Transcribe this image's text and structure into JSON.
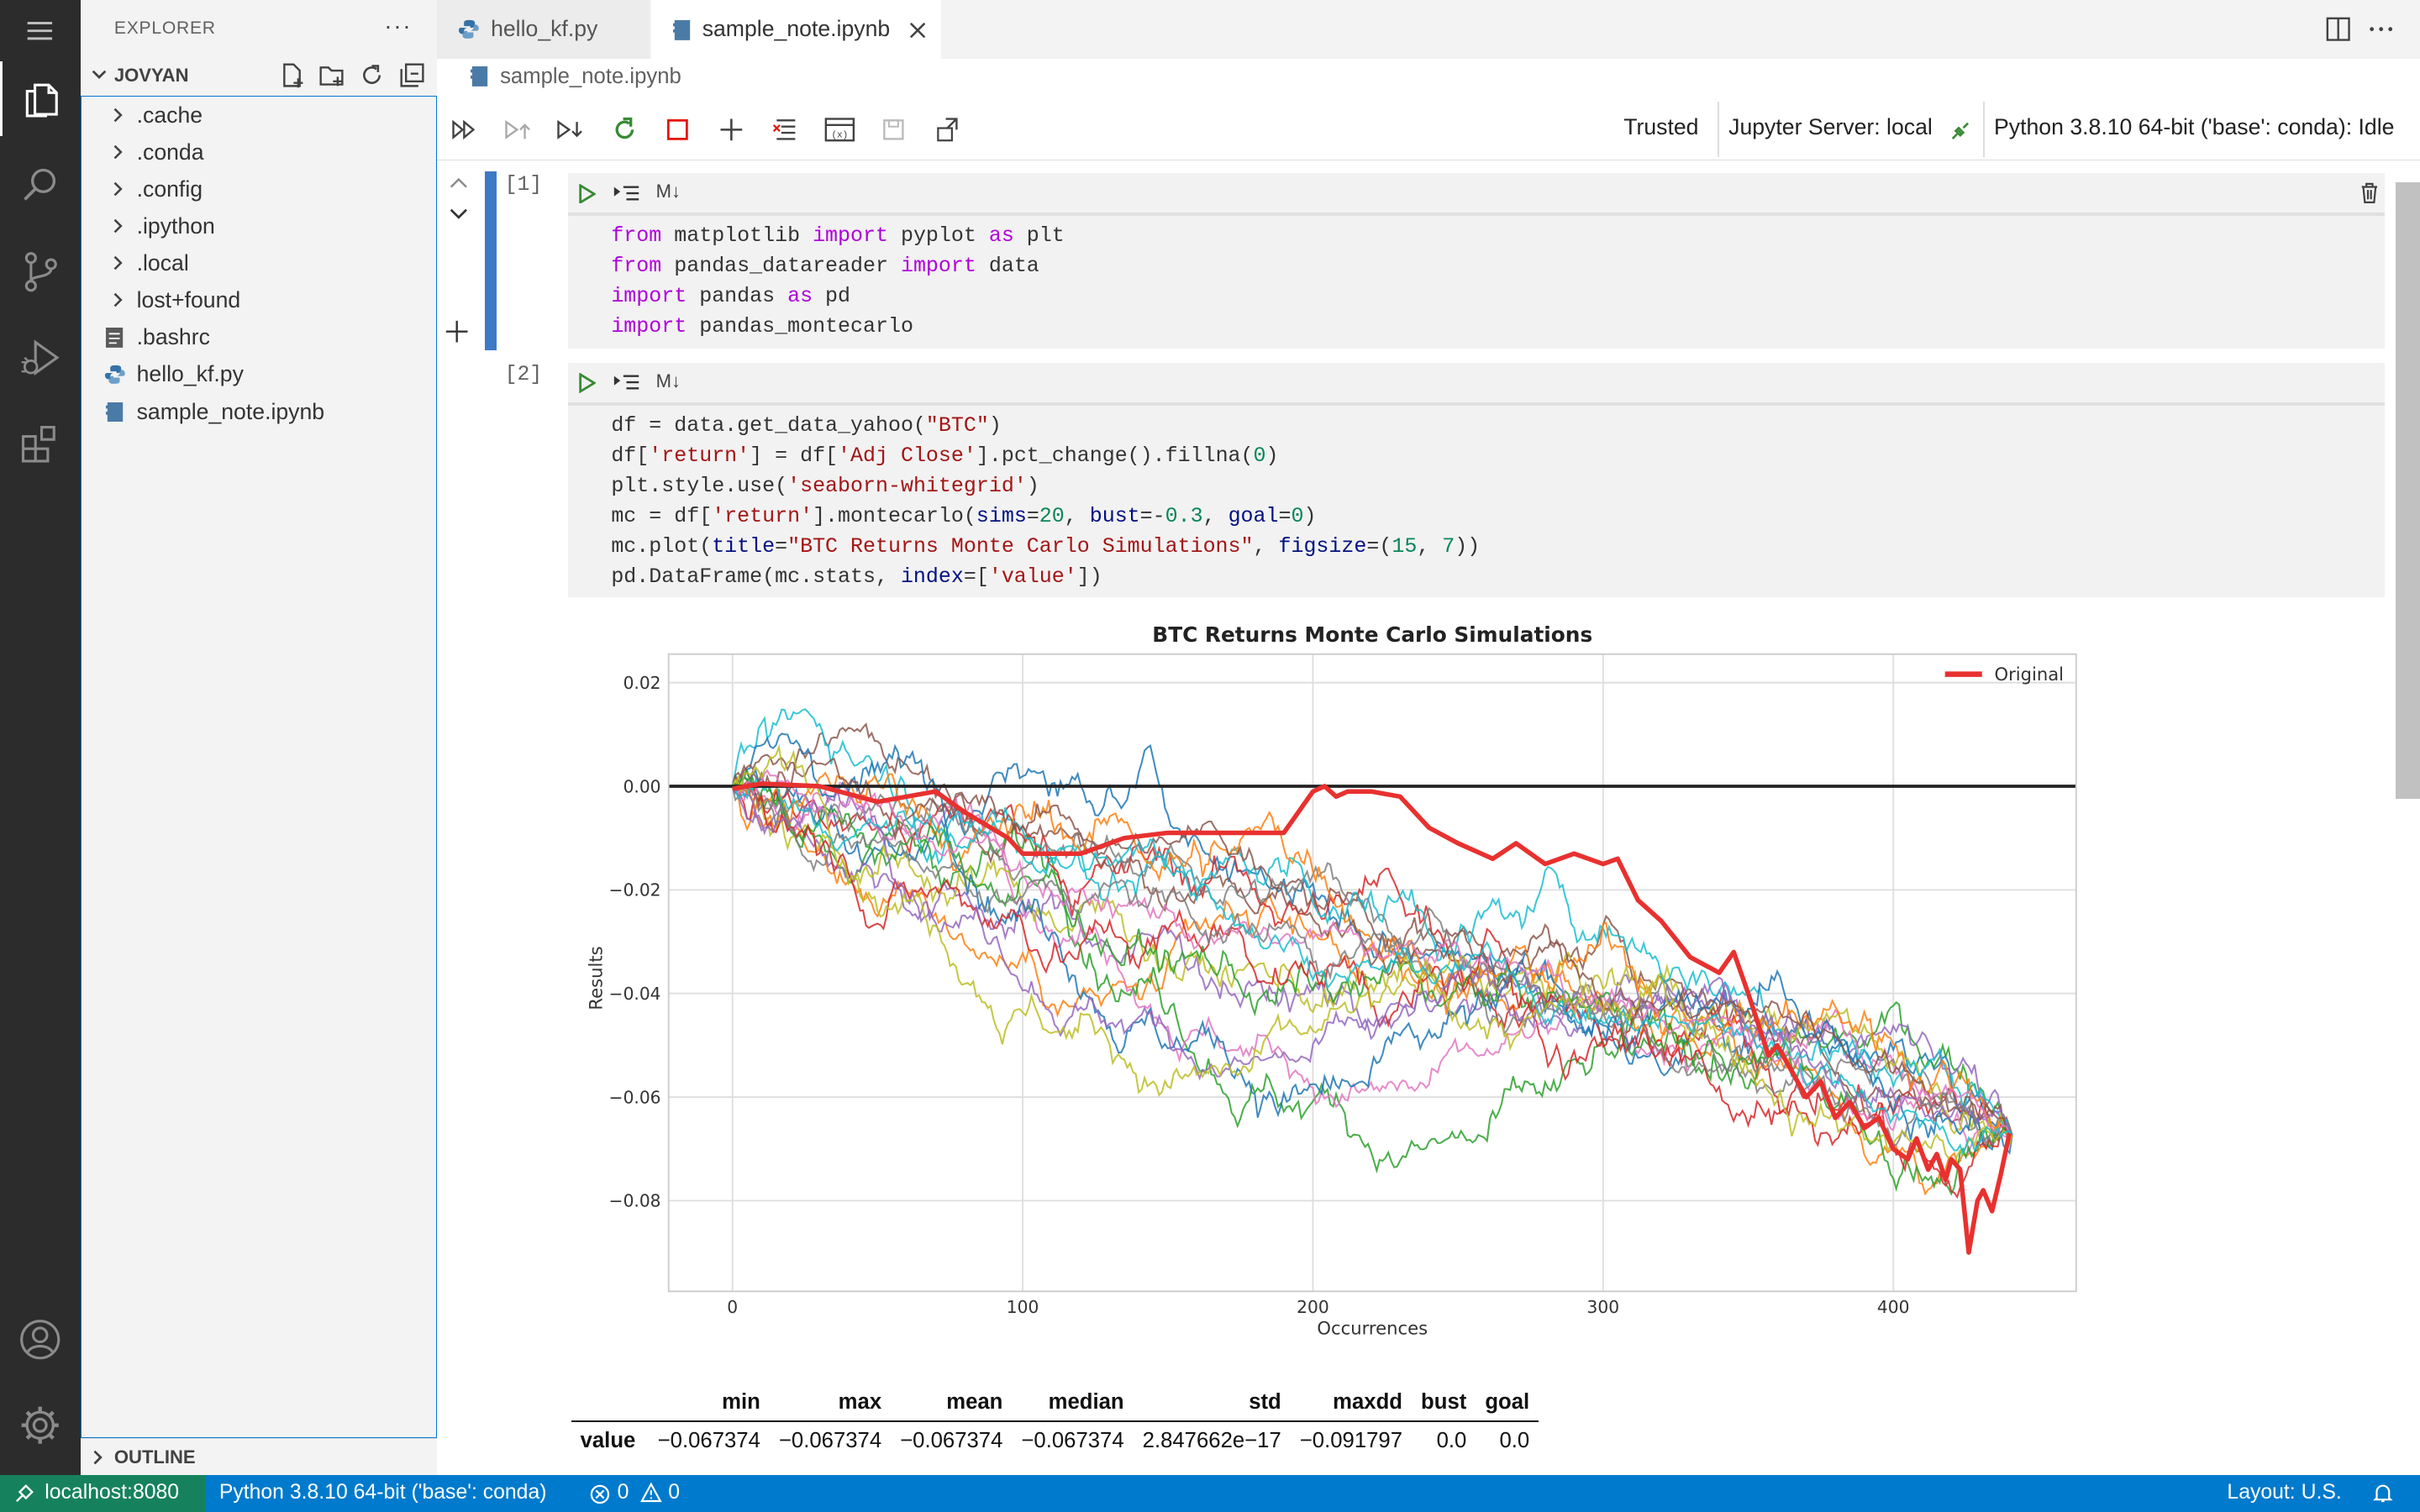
{
  "activity_bar": {
    "items": [
      "menu-icon",
      "files-icon",
      "search-icon",
      "source-control-icon",
      "run-debug-icon",
      "extensions-icon"
    ],
    "bottom": [
      "account-icon",
      "settings-gear-icon"
    ]
  },
  "sidebar": {
    "title": "EXPLORER",
    "more": "···",
    "section": "JOVYAN",
    "items": [
      {
        "label": ".cache",
        "kind": "folder"
      },
      {
        "label": ".conda",
        "kind": "folder"
      },
      {
        "label": ".config",
        "kind": "folder"
      },
      {
        "label": ".ipython",
        "kind": "folder"
      },
      {
        "label": ".local",
        "kind": "folder"
      },
      {
        "label": "lost+found",
        "kind": "folder"
      },
      {
        "label": ".bashrc",
        "kind": "file"
      },
      {
        "label": "hello_kf.py",
        "kind": "python"
      },
      {
        "label": "sample_note.ipynb",
        "kind": "notebook"
      }
    ],
    "outline": "OUTLINE"
  },
  "tabs": [
    {
      "label": "hello_kf.py",
      "active": false
    },
    {
      "label": "sample_note.ipynb",
      "active": true
    }
  ],
  "breadcrumb": "sample_note.ipynb",
  "toolbar": {
    "trusted": "Trusted",
    "server": "Jupyter Server: local",
    "kernel": "Python 3.8.10 64-bit ('base': conda): Idle"
  },
  "cells": [
    {
      "number": "[1]",
      "md_label": "M↓",
      "lines": [
        "from matplotlib import pyplot as plt",
        "from pandas_datareader import data",
        "import pandas as pd",
        "import pandas_montecarlo"
      ]
    },
    {
      "number": "[2]",
      "md_label": "M↓",
      "lines": [
        "df = data.get_data_yahoo(\"BTC\")",
        "df['return'] = df['Adj Close'].pct_change().fillna(0)",
        "plt.style.use('seaborn-whitegrid')",
        "mc = df['return'].montecarlo(sims=20, bust=-0.3, goal=0)",
        "mc.plot(title=\"BTC Returns Monte Carlo Simulations\", figsize=(15, 7))",
        "pd.DataFrame(mc.stats, index=['value'])"
      ]
    }
  ],
  "chart_data": {
    "type": "line",
    "title": "BTC Returns Monte Carlo Simulations",
    "xlabel": "Occurrences",
    "ylabel": "Results",
    "xlim": [
      -22,
      463
    ],
    "ylim": [
      -0.0975,
      0.0255
    ],
    "x_ticks": [
      0,
      100,
      200,
      300,
      400
    ],
    "x_tick_labels": [
      "0",
      "100",
      "200",
      "300",
      "400"
    ],
    "y_ticks": [
      0.02,
      0.0,
      -0.02,
      -0.04,
      -0.06,
      -0.08
    ],
    "y_tick_labels": [
      "0.02",
      "0.00",
      "−0.02",
      "−0.04",
      "−0.06",
      "−0.08"
    ],
    "grid": true,
    "legend": {
      "position": "top-right",
      "entries": [
        "Original"
      ]
    },
    "reference_line": {
      "y": 0.0,
      "color": "#222222"
    },
    "simulations": {
      "count": 20,
      "points": 442,
      "end_value": -0.067374,
      "colors": [
        "#1f77b4",
        "#ff7f0e",
        "#2ca02c",
        "#d62728",
        "#9467bd",
        "#8c564b",
        "#e377c2",
        "#7f7f7f",
        "#bcbd22",
        "#17becf"
      ]
    },
    "series": [
      {
        "name": "Original",
        "color": "#e8312f",
        "x": [
          0,
          10,
          30,
          50,
          70,
          80,
          95,
          100,
          120,
          135,
          150,
          170,
          190,
          200,
          204,
          208,
          212,
          220,
          230,
          240,
          250,
          262,
          270,
          280,
          290,
          300,
          305,
          312,
          320,
          330,
          340,
          345,
          350,
          357,
          360,
          365,
          370,
          375,
          380,
          385,
          390,
          395,
          400,
          405,
          408,
          412,
          415,
          418,
          420,
          423,
          426,
          429,
          431,
          434,
          437,
          440
        ],
        "y": [
          -0.0005,
          0.0005,
          0.0,
          -0.003,
          -0.001,
          -0.005,
          -0.01,
          -0.013,
          -0.013,
          -0.01,
          -0.009,
          -0.009,
          -0.009,
          -0.001,
          0.0,
          -0.002,
          -0.001,
          -0.001,
          -0.002,
          -0.008,
          -0.011,
          -0.014,
          -0.011,
          -0.015,
          -0.013,
          -0.015,
          -0.014,
          -0.022,
          -0.026,
          -0.033,
          -0.036,
          -0.032,
          -0.04,
          -0.052,
          -0.05,
          -0.055,
          -0.06,
          -0.057,
          -0.064,
          -0.061,
          -0.066,
          -0.064,
          -0.07,
          -0.072,
          -0.068,
          -0.074,
          -0.071,
          -0.076,
          -0.072,
          -0.074,
          -0.09,
          -0.08,
          -0.078,
          -0.082,
          -0.075,
          -0.067
        ]
      }
    ]
  },
  "stats_table": {
    "columns": [
      "min",
      "max",
      "mean",
      "median",
      "std",
      "maxdd",
      "bust",
      "goal"
    ],
    "row_label": "value",
    "values": [
      "−0.067374",
      "−0.067374",
      "−0.067374",
      "−0.067374",
      "2.847662e−17",
      "−0.091797",
      "0.0",
      "0.0"
    ]
  },
  "status_bar": {
    "remote": "localhost:8080",
    "interpreter": "Python 3.8.10 64-bit ('base': conda)",
    "errors": "0",
    "warnings": "0",
    "layout": "Layout: U.S."
  }
}
